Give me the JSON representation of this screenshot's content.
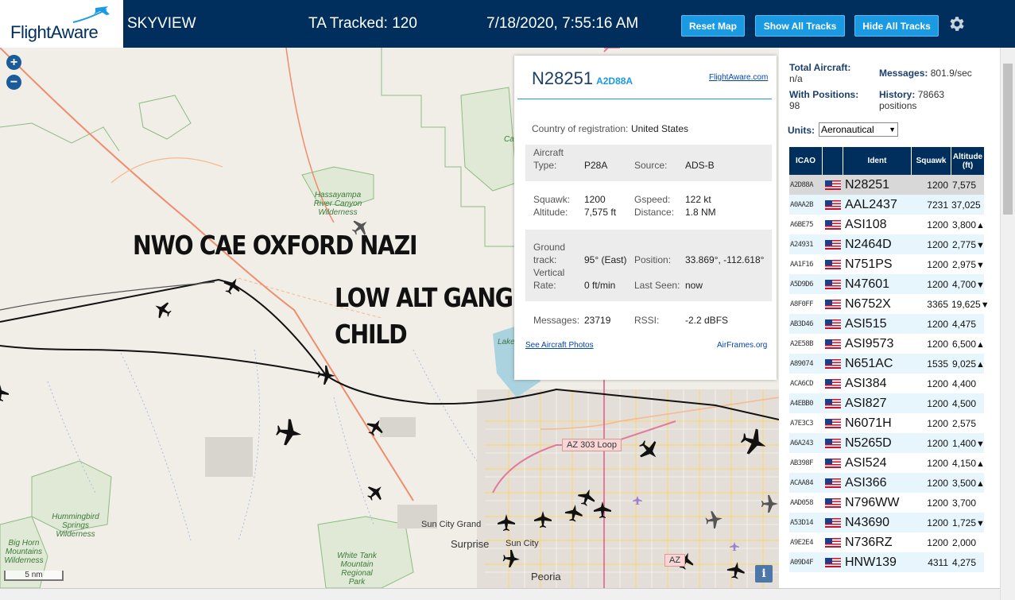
{
  "header": {
    "logo": "FlightAware",
    "app_name": "SKYVIEW",
    "tracked": "TA Tracked: 120",
    "datetime": "7/18/2020, 7:55:16 AM",
    "buttons": {
      "reset": "Reset Map",
      "show": "Show All Tracks",
      "hide": "Hide All Tracks"
    },
    "colors": {
      "bar": "#002f5d",
      "button": "#1b9ae4"
    }
  },
  "map": {
    "zoom_in": "+",
    "zoom_out": "−",
    "overlay": {
      "line1": "NWO CAE OXFORD NAZI",
      "line2": "LOW ALT GANG STALKING LOVE",
      "line3": "CHILD"
    },
    "labels": {
      "hassayampa": "Hassayampa River Canyon Wilderness",
      "hummingbird": "Hummingbird Springs Wilderness",
      "bighorn": "Big Horn Mountains Wilderness",
      "whitetank": "White Tank Mountain Regional Park",
      "cas": "Cas",
      "lake": "Lake"
    },
    "cities": {
      "suncitygrand": "Sun City Grand",
      "surprise": "Surprise",
      "suncity": "Sun City",
      "peoria": "Peoria"
    },
    "shields": {
      "loop303": "AZ 303 Loop",
      "az": "AZ"
    },
    "scale": "5 nm",
    "info": "i"
  },
  "popup": {
    "reg": "N28251",
    "icao": "A2D88A",
    "fa_link": "FlightAware.com",
    "country_label": "Country of registration:",
    "country": "United States",
    "type_label_1": "Aircraft",
    "type_label_2": "Type:",
    "type": "P28A",
    "source_label": "Source:",
    "source": "ADS-B",
    "squawk_label": "Squawk:",
    "squawk": "1200",
    "gspeed_label": "Gspeed:",
    "gspeed": "122 kt",
    "altitude_label": "Altitude:",
    "altitude": "7,575 ft",
    "distance_label": "Distance:",
    "distance": "1.8 NM",
    "track_label_1": "Ground",
    "track_label_2": "track:",
    "track": "95° (East)",
    "position_label": "Position:",
    "position": "33.869°, -112.618°",
    "vrate_label_1": "Vertical",
    "vrate_label_2": "Rate:",
    "vrate": "0 ft/min",
    "lastseen_label": "Last Seen:",
    "lastseen": "now",
    "messages_label": "Messages:",
    "messages": "23719",
    "rssi_label": "RSSI:",
    "rssi": "-2.2 dBFS",
    "photos_link": "See Aircraft Photos",
    "airframes_link": "AirFrames.org"
  },
  "side": {
    "total_label": "Total Aircraft:",
    "total": "n/a",
    "messages_label": "Messages:",
    "messages": "801.9/sec",
    "withpos_label": "With Positions:",
    "withpos": "98",
    "history_label": "History:",
    "history": "78663 positions",
    "units_label": "Units:",
    "units": "Aeronautical",
    "columns": {
      "icao": "ICAO",
      "ident": "Ident",
      "squawk": "Squawk",
      "altitude": "Altitude (ft)"
    },
    "rows": [
      {
        "icao": "A2D88A",
        "ident": "N28251",
        "squawk": "1200",
        "alt": "7,575",
        "trend": ""
      },
      {
        "icao": "A0AA2B",
        "ident": "AAL2437",
        "squawk": "7231",
        "alt": "37,025",
        "trend": ""
      },
      {
        "icao": "A6BE75",
        "ident": "ASI108",
        "squawk": "1200",
        "alt": "3,800",
        "trend": "▲"
      },
      {
        "icao": "A24931",
        "ident": "N2464D",
        "squawk": "1200",
        "alt": "2,775",
        "trend": "▼"
      },
      {
        "icao": "AA1F16",
        "ident": "N751PS",
        "squawk": "1200",
        "alt": "2,975",
        "trend": "▼"
      },
      {
        "icao": "A5D9D6",
        "ident": "N47601",
        "squawk": "1200",
        "alt": "4,700",
        "trend": "▼"
      },
      {
        "icao": "A8F0FF",
        "ident": "N6752X",
        "squawk": "3365",
        "alt": "19,625",
        "trend": "▼"
      },
      {
        "icao": "AB3D46",
        "ident": "ASI515",
        "squawk": "1200",
        "alt": "4,475",
        "trend": ""
      },
      {
        "icao": "A2E58B",
        "ident": "ASI9573",
        "squawk": "1200",
        "alt": "6,500",
        "trend": "▲"
      },
      {
        "icao": "A89074",
        "ident": "N651AC",
        "squawk": "1535",
        "alt": "9,025",
        "trend": "▲"
      },
      {
        "icao": "ACA6CD",
        "ident": "ASI384",
        "squawk": "1200",
        "alt": "4,400",
        "trend": ""
      },
      {
        "icao": "A4EBB0",
        "ident": "ASI827",
        "squawk": "1200",
        "alt": "4,500",
        "trend": ""
      },
      {
        "icao": "A7E3C3",
        "ident": "N6071H",
        "squawk": "1200",
        "alt": "2,575",
        "trend": ""
      },
      {
        "icao": "A6A243",
        "ident": "N5265D",
        "squawk": "1200",
        "alt": "1,400",
        "trend": "▼"
      },
      {
        "icao": "AB398F",
        "ident": "ASI524",
        "squawk": "1200",
        "alt": "4,150",
        "trend": "▲"
      },
      {
        "icao": "ACAA84",
        "ident": "ASI366",
        "squawk": "1200",
        "alt": "3,500",
        "trend": "▲"
      },
      {
        "icao": "AAD058",
        "ident": "N796WW",
        "squawk": "1200",
        "alt": "3,700",
        "trend": ""
      },
      {
        "icao": "A53D14",
        "ident": "N43690",
        "squawk": "1200",
        "alt": "1,725",
        "trend": "▼"
      },
      {
        "icao": "A9E2E4",
        "ident": "N736RZ",
        "squawk": "1200",
        "alt": "2,000",
        "trend": ""
      },
      {
        "icao": "A09D4F",
        "ident": "HNW139",
        "squawk": "4311",
        "alt": "4,275",
        "trend": ""
      }
    ]
  }
}
